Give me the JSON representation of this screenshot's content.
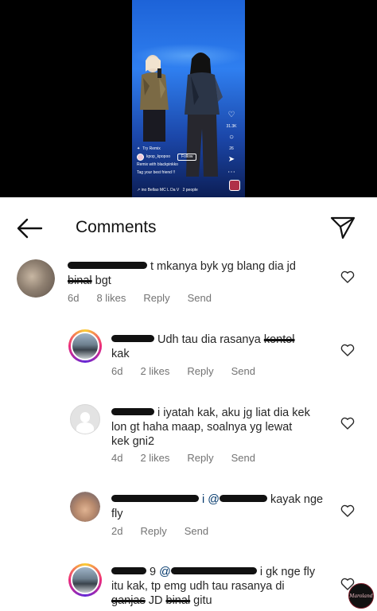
{
  "header": {
    "title": "Comments",
    "back_icon": "arrow-left-icon",
    "send_icon": "paper-plane-icon"
  },
  "video": {
    "username": "kpop_kpopoo",
    "follow_label": "Follow",
    "try_remix": "Try Remix",
    "remix_line": "Remix with blackpinkko",
    "caption": "Tag your best friend !!",
    "music": "↗ ino Bellao  MC L Da V",
    "people": "2 people",
    "likes": "31.3K",
    "comments": "26"
  },
  "comments": [
    {
      "text_after_redact": "t mkanya byk yg blang dia jd",
      "line2_struck": "binal",
      "line2_rest": " bgt",
      "time": "6d",
      "likes": "8 likes",
      "reply": "Reply",
      "send": "Send"
    },
    {
      "text_after_redact": "Udh tau dia rasanya",
      "struck": "kontol",
      "line2": "kak",
      "time": "6d",
      "likes": "2 likes",
      "reply": "Reply",
      "send": "Send"
    },
    {
      "text_after_redact": "i iyatah kak, aku jg liat dia kek",
      "line2": "lon gt haha maap, soalnya yg lewat",
      "line3": "kek gni2",
      "time": "4d",
      "likes": "2 likes",
      "reply": "Reply",
      "send": "Send"
    },
    {
      "mention": "i @",
      "text_after_redact": "kayak nge",
      "line2": "fly",
      "time": "2d",
      "reply": "Reply",
      "send": "Send"
    },
    {
      "username_tail": "9",
      "mention_prefix": "@",
      "text_after_redact": "i gk nge fly",
      "line2": "itu kak, tp emg udh tau rasanya di",
      "line3_struck": "ganjas",
      "line3_mid": " JD ",
      "line3_struck2": "binal",
      "line3_rest": " gitu"
    }
  ],
  "sticker_text": "Maroland"
}
